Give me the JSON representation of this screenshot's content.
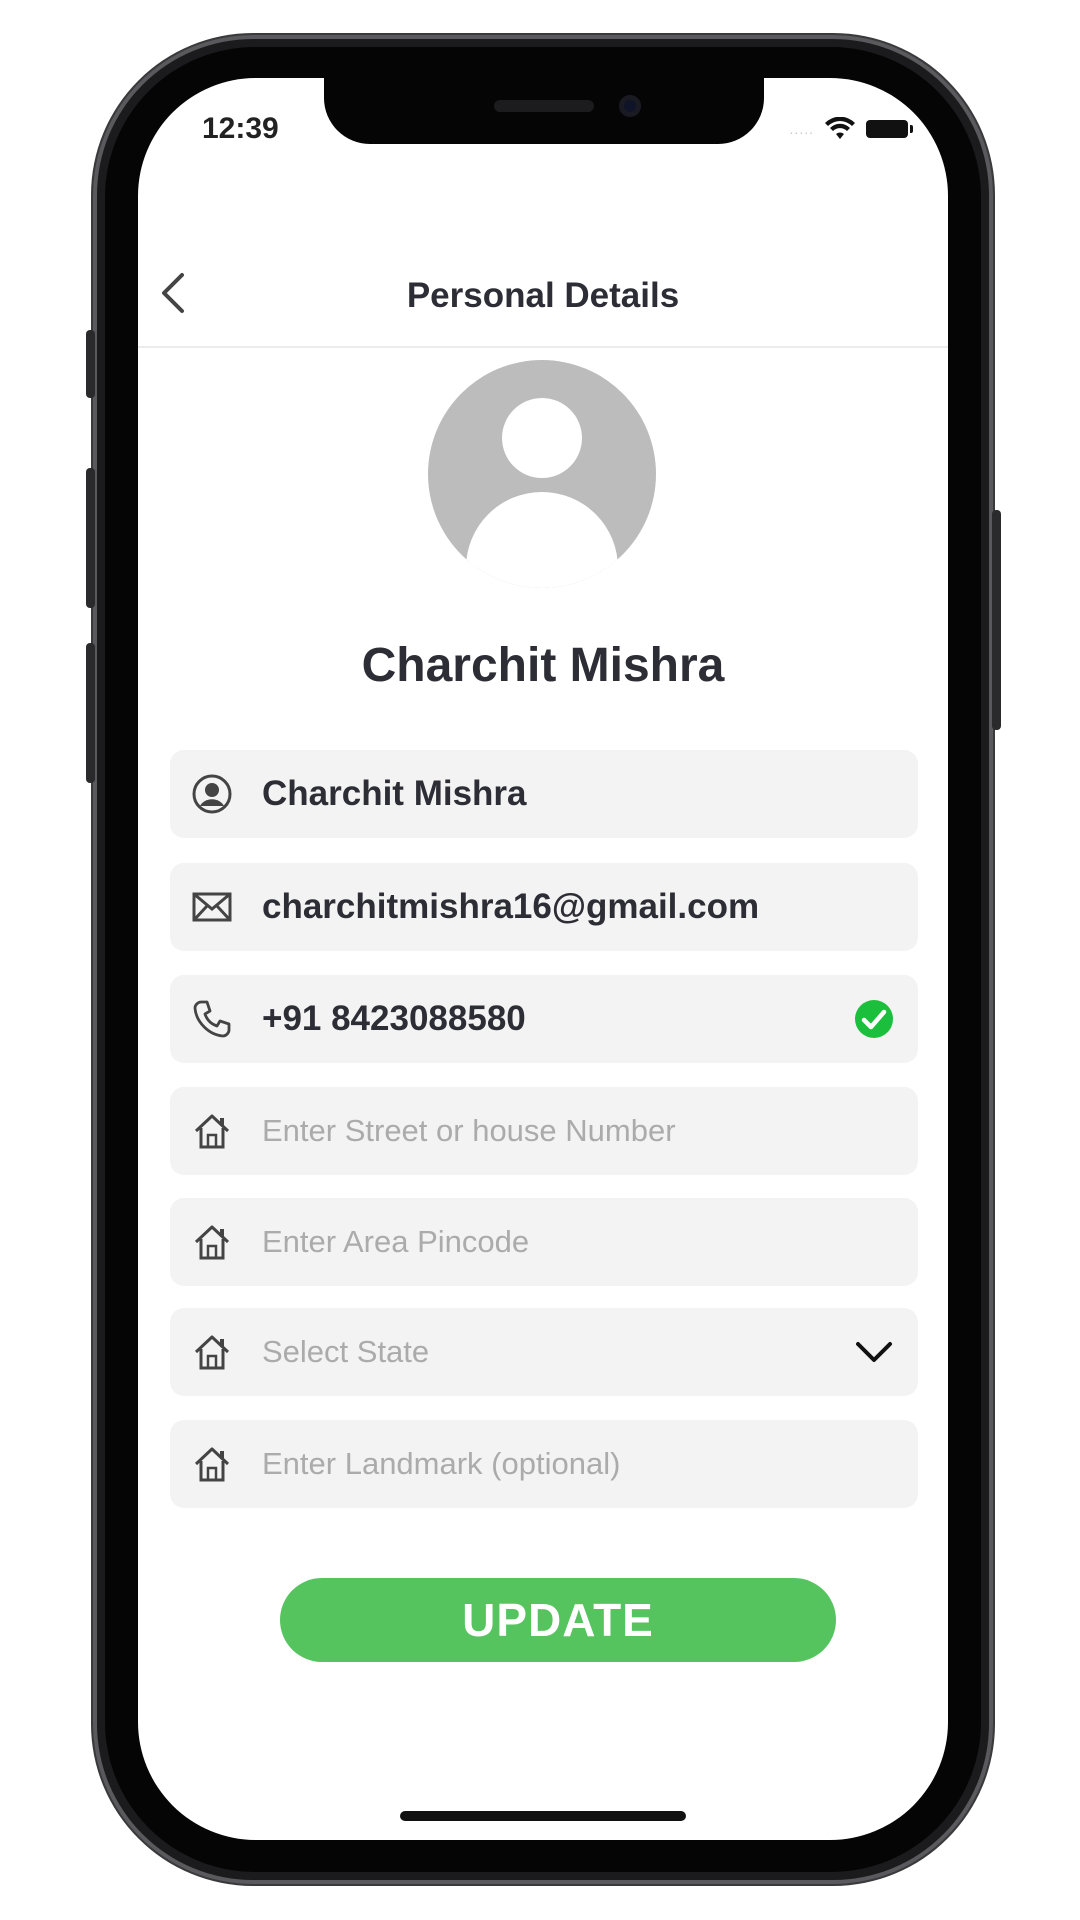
{
  "status_bar": {
    "time": "12:39",
    "signal_dots": "....."
  },
  "nav": {
    "title": "Personal Details",
    "back_icon": "chevron-left-icon"
  },
  "profile": {
    "name": "Charchit Mishra"
  },
  "fields": {
    "name": {
      "value": "Charchit Mishra",
      "icon": "user-circle-icon"
    },
    "email": {
      "value": "charchitmishra16@gmail.com",
      "icon": "mail-icon"
    },
    "phone": {
      "value": "+91 8423088580",
      "icon": "phone-icon",
      "verified": true,
      "verified_color": "#1cbf3b"
    },
    "street": {
      "placeholder": "Enter Street or house Number",
      "icon": "home-icon"
    },
    "pincode": {
      "placeholder": "Enter Area Pincode",
      "icon": "home-icon"
    },
    "state": {
      "placeholder": "Select State",
      "icon": "home-icon",
      "dropdown_icon": "chevron-down-icon"
    },
    "landmark": {
      "placeholder": "Enter Landmark (optional)",
      "icon": "home-icon"
    }
  },
  "actions": {
    "update_label": "UPDATE",
    "update_color": "#55c45e"
  }
}
